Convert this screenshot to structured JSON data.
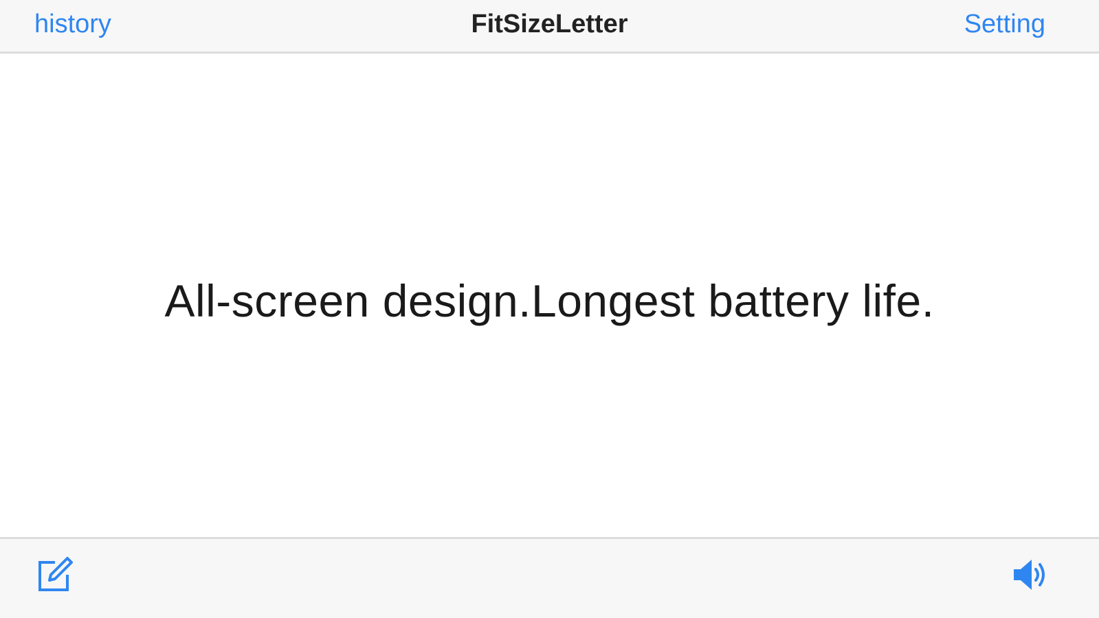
{
  "nav": {
    "left_label": "history",
    "title": "FitSizeLetter",
    "right_label": "Setting"
  },
  "content": {
    "display_text": "All-screen design.Longest battery life."
  },
  "toolbar": {
    "left_icon": "compose-icon",
    "right_icon": "speaker-icon"
  },
  "colors": {
    "accent": "#2f86f0",
    "bar_background": "#f7f7f7",
    "content_background": "#ffffff",
    "text": "#1a1a1a"
  }
}
